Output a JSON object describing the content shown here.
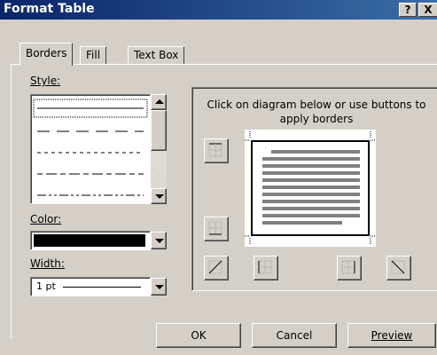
{
  "window": {
    "title": "Format Table",
    "help_button": "?",
    "close_button": "X"
  },
  "tabs": [
    {
      "label": "Borders",
      "active": true
    },
    {
      "label": "Fill",
      "active": false
    },
    {
      "label": "Text Box",
      "active": false
    }
  ],
  "style": {
    "label": "Style:",
    "line_styles": [
      "solid",
      "dashed",
      "dotted",
      "dash-dot",
      "long-dash-dot"
    ],
    "selected_index": 0
  },
  "color": {
    "label": "Color:",
    "value_color": "#000000"
  },
  "width": {
    "label": "Width:",
    "value": "1 pt"
  },
  "preview": {
    "instruction": "Click on diagram below or use buttons to apply borders"
  },
  "buttons": {
    "ok": "OK",
    "cancel": "Cancel",
    "preview": "Preview"
  }
}
